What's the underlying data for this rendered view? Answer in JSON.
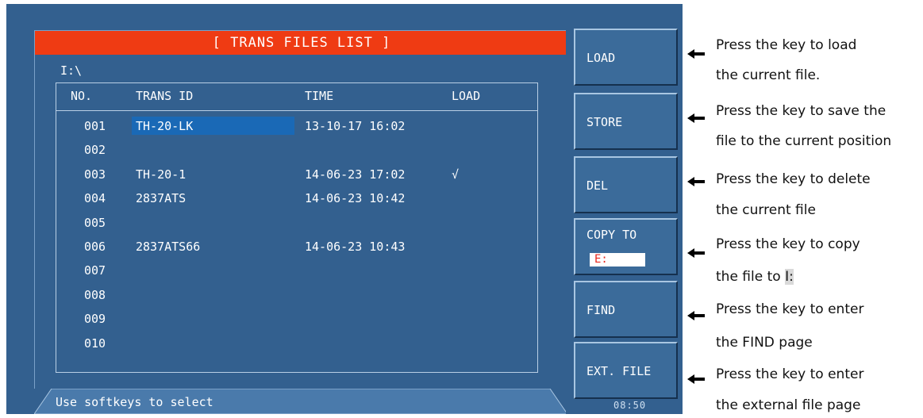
{
  "screen": {
    "title": "[ TRANS FILES LIST ]",
    "path": "I:\\",
    "columns": [
      "NO.",
      "TRANS ID",
      "TIME",
      "LOAD"
    ],
    "rows": [
      {
        "no": "001",
        "id": "TH-20-LK",
        "time": "13-10-17 16:02",
        "load": "",
        "selected": true
      },
      {
        "no": "002",
        "id": "",
        "time": "",
        "load": ""
      },
      {
        "no": "003",
        "id": "TH-20-1",
        "time": "14-06-23 17:02",
        "load": "√"
      },
      {
        "no": "004",
        "id": "2837ATS",
        "time": "14-06-23 10:42",
        "load": ""
      },
      {
        "no": "005",
        "id": "",
        "time": "",
        "load": ""
      },
      {
        "no": "006",
        "id": "2837ATS66",
        "time": "14-06-23 10:43",
        "load": ""
      },
      {
        "no": "007",
        "id": "",
        "time": "",
        "load": ""
      },
      {
        "no": "008",
        "id": "",
        "time": "",
        "load": ""
      },
      {
        "no": "009",
        "id": "",
        "time": "",
        "load": ""
      },
      {
        "no": "010",
        "id": "",
        "time": "",
        "load": ""
      }
    ],
    "status": "Use softkeys to select",
    "clock": "08:50"
  },
  "softkeys": {
    "load": "LOAD",
    "store": "STORE",
    "del": "DEL",
    "copy_to": "COPY TO",
    "copy_target": "E:",
    "find": "FIND",
    "ext_file": "EXT. FILE"
  },
  "annotations": {
    "load_1": "Press the key to load",
    "load_2": "the current file.",
    "store_1": "Press the key to save the",
    "store_2": "file to the current position",
    "del_1": "Press the key to delete",
    "del_2": "the current file",
    "copy_1": "Press the key to copy",
    "copy_2_pre": "the file to ",
    "copy_2_hl": "I:",
    "find_1": "Press the key to enter",
    "find_2": "the FIND page",
    "ext_1": "Press the key to enter",
    "ext_2": "the external file page"
  },
  "colors": {
    "screen_bg": "#33608f",
    "title_bar": "#ef3b13",
    "selection": "#1a69b6"
  }
}
